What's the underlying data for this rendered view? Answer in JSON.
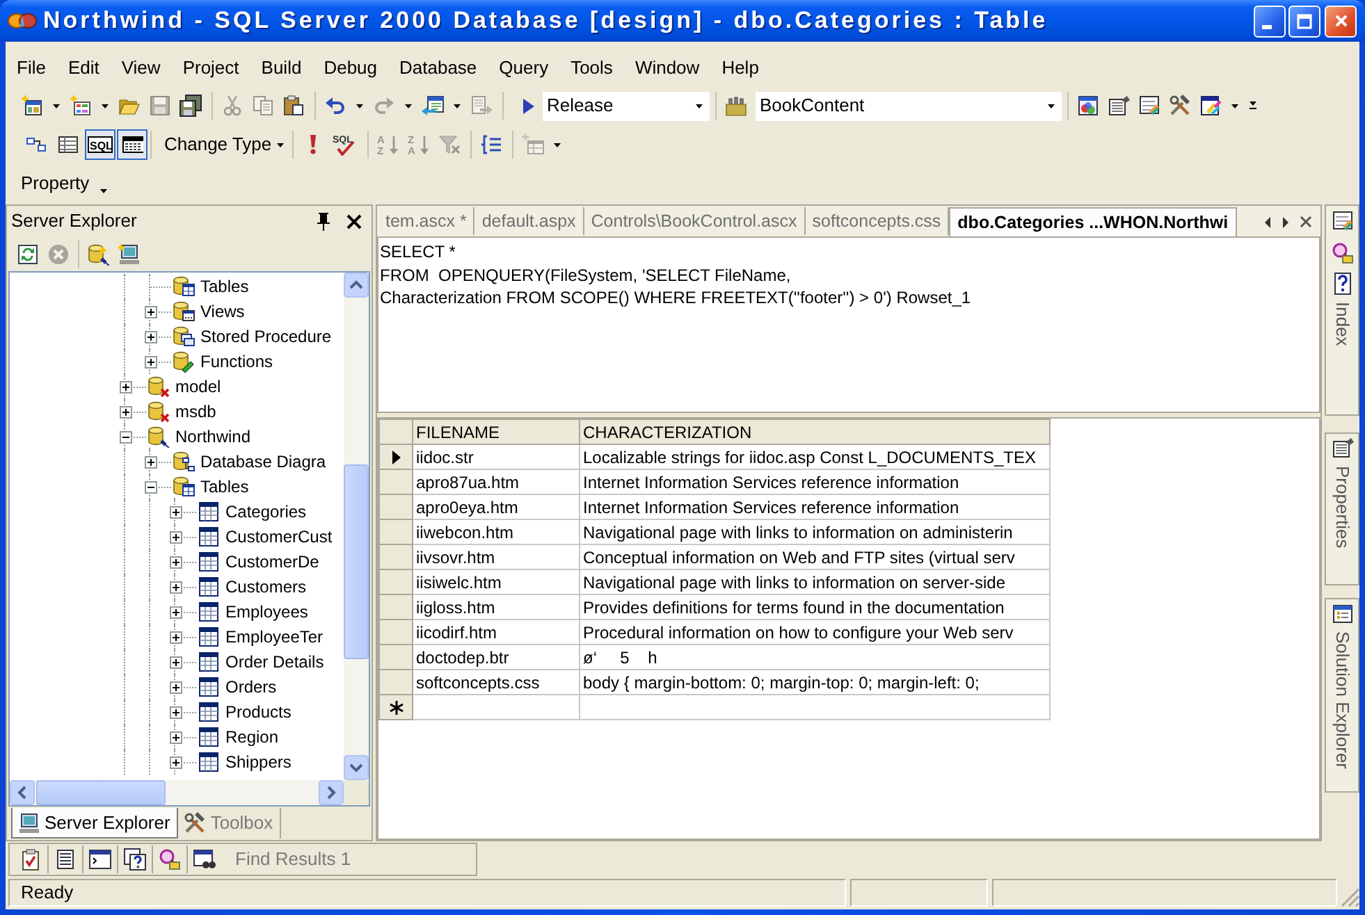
{
  "window": {
    "title": "Northwind - SQL Server 2000 Database [design] - dbo.Categories : Table"
  },
  "menu": [
    "File",
    "Edit",
    "View",
    "Project",
    "Build",
    "Debug",
    "Database",
    "Query",
    "Tools",
    "Window",
    "Help"
  ],
  "toolbar_1": {
    "buttons": [
      {
        "disabled": false
      },
      {
        "disabled": false
      },
      {
        "disabled": false
      },
      {
        "disabled": true
      },
      {
        "disabled": false
      },
      {
        "disabled": true
      },
      {
        "disabled": true
      },
      {
        "disabled": false
      },
      {
        "disabled": false
      },
      {
        "disabled": true
      },
      {
        "disabled": false
      },
      {
        "disabled": true
      },
      {
        "disabled": false
      },
      {
        "disabled": false
      },
      {
        "disabled": false
      },
      {
        "disabled": false
      },
      {
        "disabled": false
      },
      {
        "disabled": false
      },
      {
        "disabled": false
      }
    ],
    "configuration": "Release",
    "project": "BookContent"
  },
  "toolbar_2": {
    "panes": [
      {
        "kind": "diagram",
        "on": false
      },
      {
        "kind": "grid",
        "on": false
      },
      {
        "kind": "sql",
        "label": "SQL",
        "on": true
      },
      {
        "kind": "results",
        "on": true
      }
    ],
    "change_type": "Change Type",
    "buttons": [
      {
        "kind": "run",
        "disabled": false
      },
      {
        "kind": "verify",
        "label": "SQL",
        "disabled": false
      },
      {
        "kind": "sort",
        "top": "A",
        "bottom": "Z",
        "disabled": true
      },
      {
        "kind": "sort",
        "top": "Z",
        "bottom": "A",
        "disabled": true
      },
      {
        "kind": "filter",
        "disabled": true
      },
      {
        "kind": "group",
        "disabled": false
      },
      {
        "kind": "addtable",
        "disabled": true
      }
    ]
  },
  "toolbar_3": {
    "label": "Property"
  },
  "server_explorer": {
    "title": "Server Explorer",
    "tools": [
      {
        "disabled": false
      },
      {
        "disabled": true
      },
      {
        "disabled": false
      },
      {
        "disabled": false
      }
    ],
    "tree": [
      {
        "children": [
          {
            "label": "Tables",
            "kind": "tables",
            "expandable": false
          },
          {
            "label": "Views",
            "kind": "views",
            "expandable": true,
            "expanded": false
          },
          {
            "label": "Stored Procedure",
            "kind": "procedures",
            "expandable": true,
            "expanded": false
          },
          {
            "label": "Functions",
            "kind": "functions",
            "expandable": true,
            "expanded": false
          }
        ]
      },
      {
        "label": "model",
        "kind": "database",
        "connected": false,
        "expandable": true,
        "expanded": false
      },
      {
        "label": "msdb",
        "kind": "database",
        "connected": false,
        "expandable": true,
        "expanded": false
      },
      {
        "label": "Northwind",
        "kind": "database",
        "connected": true,
        "expandable": true,
        "expanded": true,
        "children": [
          {
            "label": "Database Diagra",
            "kind": "diagrams",
            "expandable": true,
            "expanded": false
          },
          {
            "label": "Tables",
            "kind": "tables",
            "expandable": true,
            "expanded": true,
            "children": [
              {
                "label": "Categories",
                "kind": "table",
                "expandable": true,
                "expanded": false
              },
              {
                "label": "CustomerCust",
                "kind": "table",
                "expandable": true,
                "expanded": false
              },
              {
                "label": "CustomerDe",
                "kind": "table",
                "expandable": true,
                "expanded": false
              },
              {
                "label": "Customers",
                "kind": "table",
                "expandable": true,
                "expanded": false
              },
              {
                "label": "Employees",
                "kind": "table",
                "expandable": true,
                "expanded": false
              },
              {
                "label": "EmployeeTer",
                "kind": "table",
                "expandable": true,
                "expanded": false
              },
              {
                "label": "Order Details",
                "kind": "table",
                "expandable": true,
                "expanded": false
              },
              {
                "label": "Orders",
                "kind": "table",
                "expandable": true,
                "expanded": false
              },
              {
                "label": "Products",
                "kind": "table",
                "expandable": true,
                "expanded": false
              },
              {
                "label": "Region",
                "kind": "table",
                "expandable": true,
                "expanded": false
              },
              {
                "label": "Shippers",
                "kind": "table",
                "expandable": true,
                "expanded": false
              }
            ]
          }
        ]
      }
    ],
    "tabs": [
      {
        "label": "Server Explorer",
        "selected": true
      },
      {
        "label": "Toolbox",
        "selected": false
      }
    ]
  },
  "editor": {
    "tabs": [
      {
        "label": "tem.ascx *",
        "selected": false
      },
      {
        "label": "default.aspx",
        "selected": false
      },
      {
        "label": "Controls\\BookControl.ascx",
        "selected": false
      },
      {
        "label": "softconcepts.css",
        "selected": false
      },
      {
        "label": "dbo.Categories ...WHON.Northwi",
        "selected": true
      }
    ],
    "sql": [
      "SELECT *",
      "FROM  OPENQUERY(FileSystem, 'SELECT FileName,",
      "Characterization FROM SCOPE() WHERE FREETEXT(''footer'') > 0') Rowset_1"
    ],
    "results": {
      "columns": [
        "FILENAME",
        "CHARACTERIZATION"
      ],
      "rows": [
        {
          "filename": "iidoc.str",
          "characterization": "Localizable strings for iidoc.asp Const L_DOCUMENTS_TEX",
          "selected": true
        },
        {
          "filename": "apro87ua.htm",
          "characterization": "Internet Information Services reference information",
          "selected": false
        },
        {
          "filename": "apro0eya.htm",
          "characterization": "Internet Information Services reference information",
          "selected": false
        },
        {
          "filename": "iiwebcon.htm",
          "characterization": "Navigational page with links to information on administerin",
          "selected": false
        },
        {
          "filename": "iivsovr.htm",
          "characterization": "Conceptual information on Web and FTP sites (virtual serv",
          "selected": false
        },
        {
          "filename": "iisiwelc.htm",
          "characterization": "Navigational page with links to information on server-side",
          "selected": false
        },
        {
          "filename": "iigloss.htm",
          "characterization": "Provides definitions for terms found in the documentation",
          "selected": false
        },
        {
          "filename": "iicodirf.htm",
          "characterization": "Procedural information on how to configure your Web serv",
          "selected": false
        },
        {
          "filename": "doctodep.btr",
          "characterization": "ø‘     5    h",
          "selected": false
        },
        {
          "filename": "softconcepts.css",
          "characterization": "body { margin-bottom: 0; margin-top: 0; margin-left: 0;",
          "selected": false
        }
      ]
    }
  },
  "right_dock": [
    {
      "label": "Index"
    },
    {
      "label": "Properties"
    },
    {
      "label": "Solution Explorer"
    }
  ],
  "tool_windows": {
    "find_results": "Find Results 1"
  },
  "status_bar": {
    "text": "Ready"
  }
}
